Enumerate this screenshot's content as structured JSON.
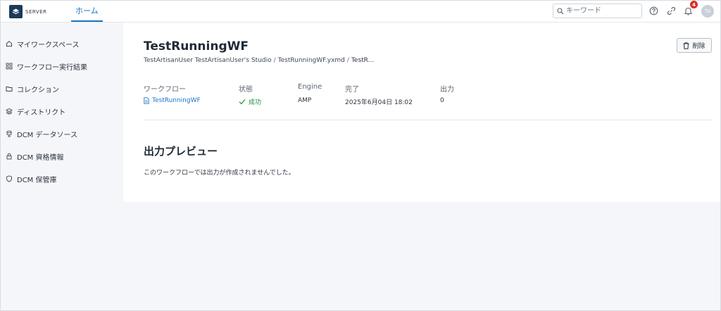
{
  "header": {
    "logo_text": "SERVER",
    "nav_home": "ホーム",
    "search_placeholder": "キーワード",
    "notification_count": "4",
    "avatar_initials": "TA"
  },
  "sidebar": {
    "items": [
      {
        "label": "マイワークスペース",
        "icon": "home-icon"
      },
      {
        "label": "ワークフロー実行結果",
        "icon": "workflow-results-icon"
      },
      {
        "label": "コレクション",
        "icon": "folder-icon"
      },
      {
        "label": "ディストリクト",
        "icon": "layers-icon"
      },
      {
        "label": "DCM データソース",
        "icon": "database-icon"
      },
      {
        "label": "DCM 資格情報",
        "icon": "lock-icon"
      },
      {
        "label": "DCM 保管庫",
        "icon": "shield-icon"
      }
    ]
  },
  "main": {
    "title": "TestRunningWF",
    "breadcrumb": {
      "owner": "TestArtisanUser TestArtisanUser's Studio",
      "sep1": "/",
      "file": "TestRunningWF.yxmd",
      "sep2": "/",
      "current": "TestR..."
    },
    "delete_label": "削除",
    "columns": {
      "workflow": {
        "header": "ワークフロー",
        "value": "TestRunningWF"
      },
      "status": {
        "header": "状態",
        "value": "成功"
      },
      "engine": {
        "header": "Engine",
        "value": "AMP"
      },
      "completed": {
        "header": "完了",
        "value": "2025年6月04日 18:02"
      },
      "output": {
        "header": "出力",
        "value": "0"
      }
    },
    "preview_title": "出力プレビュー",
    "preview_empty": "このワークフローでは出力が作成されませんでした。"
  },
  "colors": {
    "accent": "#1a73c8",
    "success": "#1e8e3e",
    "badge": "#d93025",
    "logo_bg": "#1b3a5c"
  }
}
